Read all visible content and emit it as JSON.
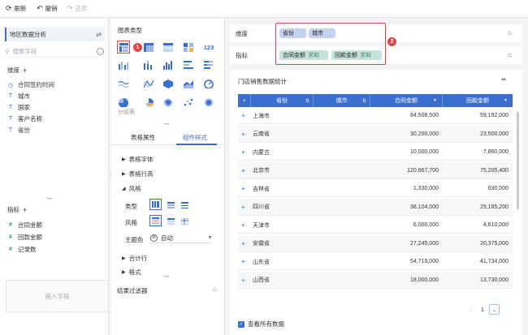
{
  "toolbar": {
    "refresh": "刷新",
    "undo": "撤销",
    "redo": "还原"
  },
  "left": {
    "dataset": "地区数据分析",
    "search_placeholder": "搜索字段",
    "dimension_title": "维度",
    "dimensions": [
      "合同签约时间",
      "城市",
      "国家",
      "客户名称",
      "省份"
    ],
    "measure_title": "指标",
    "measures": [
      "合同金额",
      "回款金额",
      "记录数"
    ]
  },
  "middle": {
    "chart_type_title": "图表类型",
    "grouped_table_label": "分组表",
    "tabs": [
      "表格属性",
      "组件样式"
    ],
    "props": [
      "表格字体",
      "表格行高",
      "风格",
      "合计行",
      "格式"
    ],
    "style": {
      "type_label": "类型",
      "style_label": "风格",
      "theme_label": "主题色",
      "theme_value": "自动"
    },
    "filter_title": "结果过滤器",
    "filter_placeholder": "拖入字段"
  },
  "right": {
    "dim_label": "维度",
    "measure_label": "指标",
    "dim_chips": [
      "省份",
      "城市"
    ],
    "measure_chips": [
      {
        "name": "合同金额",
        "agg": "求和"
      },
      {
        "name": "回款金额",
        "agg": "求和"
      }
    ],
    "badge1": "1",
    "badge2": "2",
    "card_title": "门店销售数据统计",
    "columns": [
      "省份",
      "城市",
      "合同金额",
      "回款金额"
    ],
    "rows": [
      [
        "上海市",
        "84,508,500",
        "59,192,000"
      ],
      [
        "云南省",
        "30,200,000",
        "23,500,000"
      ],
      [
        "内蒙古",
        "10,000,000",
        "7,860,000"
      ],
      [
        "北京市",
        "120,667,700",
        "75,205,400"
      ],
      [
        "吉林省",
        "1,330,000",
        "630,000"
      ],
      [
        "四川省",
        "38,104,000",
        "29,185,200"
      ],
      [
        "天津市",
        "6,000,000",
        "4,610,000"
      ],
      [
        "安徽省",
        "27,245,000",
        "20,375,000"
      ],
      [
        "山东省",
        "54,719,000",
        "41,734,000"
      ],
      [
        "山西省",
        "18,000,000",
        "13,730,000"
      ]
    ],
    "page": "1",
    "view_all": "查看所有数据"
  },
  "colors": {
    "accent": "#3a6fd0",
    "red": "#e64545",
    "measure": "#2a9d70"
  }
}
